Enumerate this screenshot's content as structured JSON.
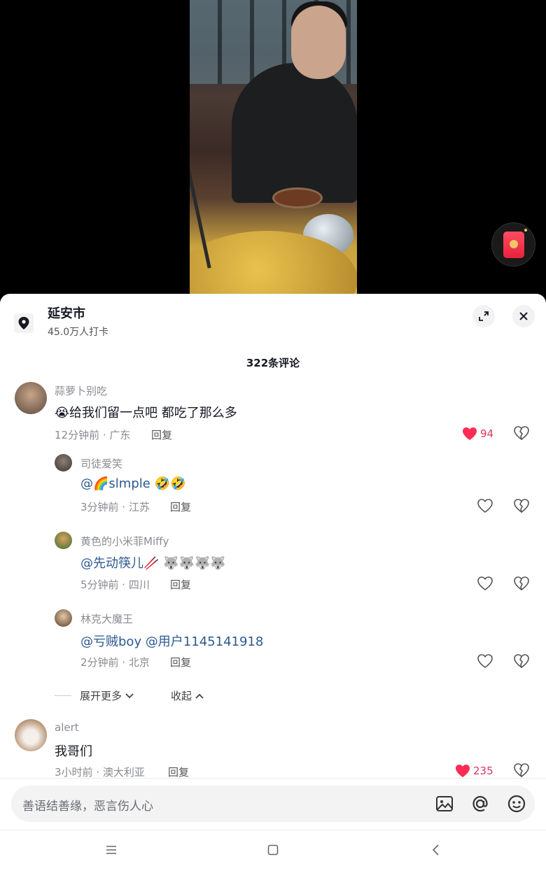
{
  "location": {
    "title": "延安市",
    "subtitle": "45.0万人打卡"
  },
  "comments_count": "322条评论",
  "comments": [
    {
      "user": "蒜萝卜别吃",
      "emoji": "😭",
      "text": "给我们留一点吧 都吃了那么多",
      "meta": "12分钟前 · 广东",
      "reply_label": "回复",
      "likes": "94",
      "liked": true,
      "replies": [
        {
          "user": "司徒爱笑",
          "mention": "@🌈slmple",
          "text": " 🤣🤣",
          "meta": "3分钟前 · 江苏",
          "reply_label": "回复"
        },
        {
          "user": "黄色的小米菲Miffy",
          "mention": "@先动筷儿🥢",
          "text": " 🐺🐺🐺🐺",
          "meta": "5分钟前 · 四川",
          "reply_label": "回复"
        },
        {
          "user": "林克大魔王",
          "mention": "@亏贼boy @用户1145141918",
          "text": "",
          "meta": "2分钟前 · 北京",
          "reply_label": "回复"
        }
      ],
      "expand_more": "展开更多",
      "collapse": "收起"
    },
    {
      "user": "alert",
      "text": "我哥们",
      "meta": "3小时前 · 澳大利亚",
      "reply_label": "回复",
      "likes": "235",
      "liked": true
    }
  ],
  "input": {
    "placeholder": "善语结善缘，恶言伤人心"
  },
  "icons": {
    "location": "location-pin-icon",
    "expand": "expand-icon",
    "close": "close-icon",
    "image": "image-icon",
    "at": "at-icon",
    "emoji": "emoji-icon",
    "menu": "menu-icon",
    "home": "home-icon",
    "back": "back-icon",
    "redpacket": "red-packet-icon"
  },
  "colors": {
    "like": "#fe2c55",
    "mention": "#2b5a8f"
  }
}
